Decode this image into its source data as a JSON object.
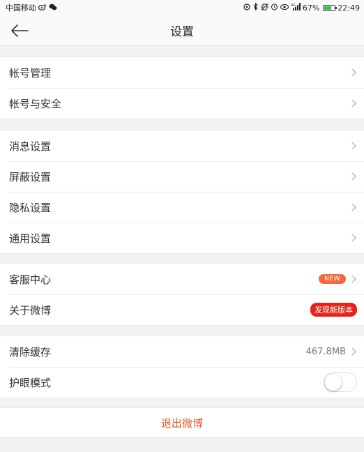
{
  "status_bar": {
    "carrier": "中国移动",
    "signal_text": "4G",
    "battery": "67%",
    "battery_level": 0.67,
    "time": "22:49",
    "battery_color": "#37c24a"
  },
  "header": {
    "title": "设置",
    "back_icon": "arrow-left-icon"
  },
  "groups": [
    {
      "items": [
        {
          "label": "帐号管理"
        },
        {
          "label": "帐号与安全"
        }
      ]
    },
    {
      "items": [
        {
          "label": "消息设置"
        },
        {
          "label": "屏蔽设置"
        },
        {
          "label": "隐私设置"
        },
        {
          "label": "通用设置"
        }
      ]
    },
    {
      "items": [
        {
          "label": "客服中心",
          "badge": "NEW"
        },
        {
          "label": "关于微博",
          "badge": "发现新版本"
        }
      ]
    },
    {
      "items": [
        {
          "label": "清除缓存",
          "value": "467.8MB"
        },
        {
          "label": "护眼模式",
          "toggle": false
        }
      ]
    }
  ],
  "logout_label": "退出微博",
  "colors": {
    "accent": "#e5582a",
    "badge_new": "#f26b40",
    "badge_update": "#e5241b"
  }
}
